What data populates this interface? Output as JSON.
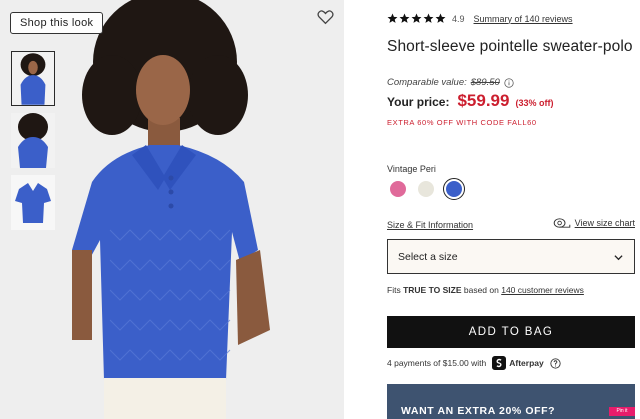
{
  "gallery": {
    "shop_the_look_label": "Shop this look",
    "thumbnail_count": 3
  },
  "product": {
    "rating_value": "4.9",
    "rating_stars": 5,
    "reviews_link_label": "Summary of 140 reviews",
    "title": "Short-sleeve pointelle sweater-polo",
    "comparable_label": "Comparable value:",
    "comparable_price": "$89.50",
    "price_label": "Your price:",
    "price": "$59.99",
    "discount": "(33% off)",
    "promo": "EXTRA 60% OFF WITH CODE FALL60"
  },
  "colors": {
    "selected_name": "Vintage Peri",
    "swatches": [
      {
        "name": "pink",
        "hex": "#e06a9a",
        "selected": false
      },
      {
        "name": "cream",
        "hex": "#e8e6dc",
        "selected": false
      },
      {
        "name": "vintage-peri",
        "hex": "#3b5fc9",
        "selected": true
      }
    ]
  },
  "size": {
    "fit_info_label": "Size & Fit Information",
    "size_chart_label": "View size chart",
    "select_label": "Select a size",
    "fit_prefix": "Fits",
    "fit_value": "TRUE TO SIZE",
    "fit_middle": "based on",
    "fit_reviews_label": "140 customer reviews"
  },
  "cart": {
    "add_to_bag_label": "ADD TO BAG",
    "afterpay_text": "4 payments of $15.00 with",
    "afterpay_brand": "Afterpay"
  },
  "banner": {
    "text": "WANT AN EXTRA 20% OFF?",
    "pin_label": "Pin it"
  },
  "colors_theme": {
    "sale_red": "#cc1f2f",
    "button_black": "#111111",
    "banner_navy": "#3e5370",
    "garment_blue": "#3b5fc9"
  }
}
